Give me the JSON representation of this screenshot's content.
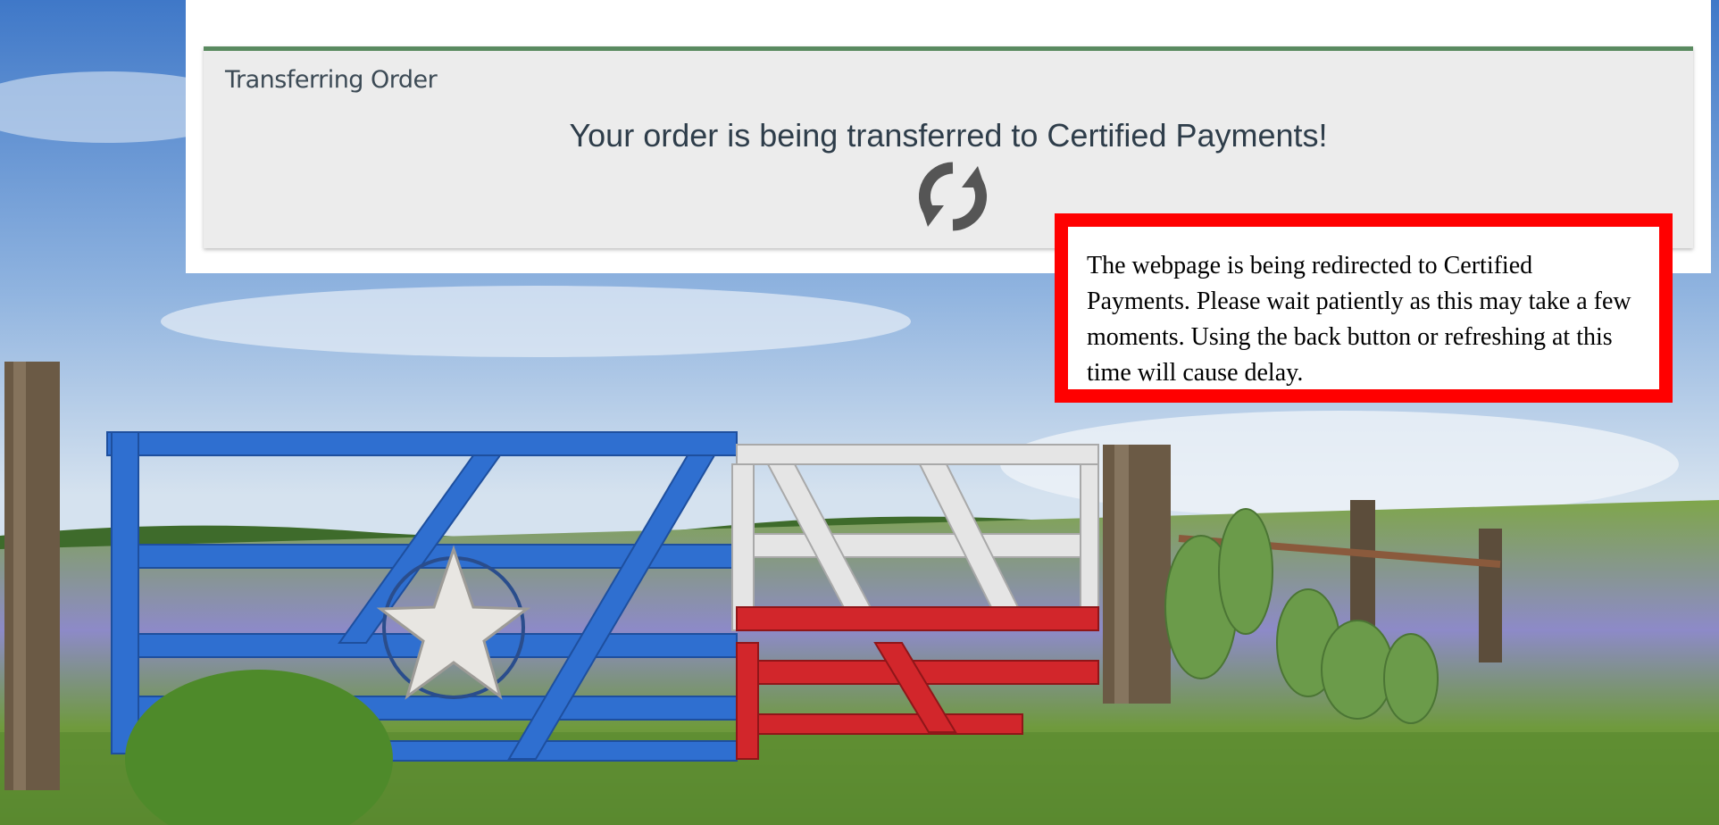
{
  "panel": {
    "title": "Transferring Order",
    "message": "Your order is being transferred to Certified Payments!",
    "accent_color": "#5a8a60",
    "spinner_icon": "refresh-icon"
  },
  "notice": {
    "text": "The webpage is being redirected to Certified Payments. Please wait patiently as this may take a few moments. Using the back button or refreshing at this time will cause delay.",
    "border_color": "#ff0000"
  },
  "background": {
    "description_icon": "texas-flag-gate-image"
  }
}
